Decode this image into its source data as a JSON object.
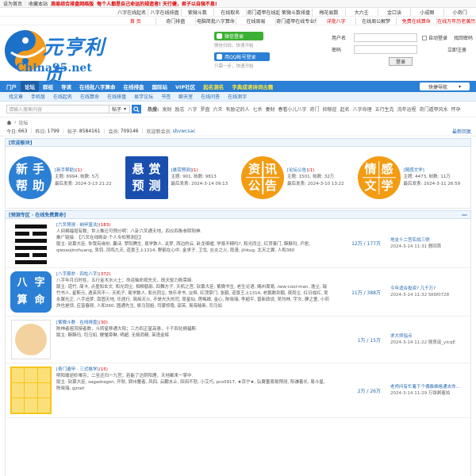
{
  "topbar": {
    "set_home": "设为首页",
    "bookmark": "收藏本站",
    "promo1": "周易综合排盘网络版",
    "promo2": "每个人都是自己命运的规造者! 天行健，君子以自强不息!"
  },
  "links1": [
    "八字在线起名",
    "八字在线排盘",
    "紫微斗数",
    "在线取名",
    "奇门遁甲在线起局",
    "紫微斗数排盘",
    "梅花易数",
    "大六壬",
    "金口诀",
    "小成图",
    "小奇门"
  ],
  "links2": [
    "首 页",
    "奇门排盘",
    "电脑简批八字算命",
    "在线周易",
    "奇门遁甲在线专业版",
    "详批八字",
    "在线周公解梦",
    "免费在线算命",
    "在线万年历老黄历"
  ],
  "links2_hot": [
    0,
    5,
    7,
    8
  ],
  "logo": {
    "cn": "元亨利贞",
    "url": "China95.net"
  },
  "social": {
    "wx_label": "微信登录",
    "wx_note": "微信扫码，快速开始",
    "qq_label": "用QQ帐号登录",
    "qq_note": "只需一步，快速开始"
  },
  "login": {
    "user_label": "用户名",
    "pass_label": "密码",
    "auto_login": "自动登录",
    "retrieve": "找回密码",
    "register": "立即注册",
    "login_btn": "登录"
  },
  "nav": {
    "items": [
      "门户",
      "论坛",
      "群组",
      "导读",
      "在线批八字算命",
      "在线排盘",
      "国际站",
      "VIP社区",
      "起名测名",
      "字典成语诗词古籍"
    ],
    "yellow": [
      8,
      9
    ],
    "quick": "快捷导航"
  },
  "subnav": [
    "找文章",
    "手机版",
    "在线起名",
    "在线算命",
    "在线排盘",
    "易学论坛",
    "书签",
    "聊天室",
    "在线问答",
    "在线测字"
  ],
  "search": {
    "placeholder": "请输入搜索内容",
    "scope": "帖子",
    "hot_label": "热搜:",
    "hot": [
      "发财",
      "励志",
      "八字",
      "罗盘",
      "六爻",
      "有励记的人",
      "七杀",
      "妻财",
      "春看小儿八字",
      "奇门",
      "抑郁症",
      "起名",
      "八字命理",
      "五行生克",
      "流年运程",
      "奇门遁甲风水",
      "怀孕"
    ]
  },
  "crumb": {
    "home_icon": "home-icon",
    "sep": "›",
    "current": "论坛"
  },
  "stats": {
    "today_label": "今日:",
    "today": "663",
    "yesterday_label": "昨日:",
    "yesterday": "1799",
    "posts_label": "帖子:",
    "posts": "8584161",
    "members_label": "会员:",
    "members": "709146",
    "welcome_label": "欢迎新会员:",
    "newest": "sbvwcsac",
    "latest_link": "最新回复"
  },
  "welcome_section": {
    "title": "[欢迎板块]"
  },
  "welcome": [
    {
      "icon_chars": [
        "新",
        "手",
        "帮",
        "助"
      ],
      "title": "[新手帮助]",
      "count": "(1)",
      "topics": "主题: 6994, 帖数: 5万",
      "last": "最后发表: 2024-3-13 21:22"
    },
    {
      "icon_chars": [
        "悬",
        "赏",
        "预",
        "测"
      ],
      "title": "[悬赏预测]",
      "count": "(1)",
      "topics": "主题: 901, 帖数: 9813",
      "last": "最后发表: 2024-3-14 09:13"
    },
    {
      "icon_chars": [
        "资",
        "讯",
        "公",
        "告"
      ],
      "title": "[论坛公告]",
      "count": "(1)",
      "topics": "主题: 1501, 帖数: 32万",
      "last": "最后发表: 2024-3-10 13:22"
    },
    {
      "icon_chars": [
        "情",
        "感",
        "文",
        "学"
      ],
      "title": "[随感文学]",
      "count": "",
      "topics": "主题: 4473, 帖数: 11万",
      "last": "最后发表: 2024-3-11 26:59"
    }
  ],
  "forum_section": {
    "title": "[预测专区 · 在线免费算命]",
    "collapse": "—"
  },
  "forums": [
    {
      "title": "[六爻预测 · 纳甲筮法]",
      "count": "(183)",
      "lines": [
        "人间祸福增有数，世上推迁可预分明：八卦六爻通天地，四仪四象参阴阳神.",
        "推广链接: 【六爻在线断卦·个人专知预测区】",
        "版主: 钦慕大臣, 你我有缘份, 囊诗, 梦阳腾生, 易学数人, 关梦, 西边的云, 卧龙嗔嘘, 学易不精吗?, 和光同尘, 红顶事门, 酥酥玛, 卢居, qwoaojinzhuang, 吴钧, 凤鸣九天, 道景王上1314, 野鹤在心中, 金求子, 卫戈, 炎炎之火, 雨漫, jihkug, 北天之翼, 人和360"
      ],
      "stat": "12万 / 177万",
      "last_title": "地支十二宫实战三例",
      "last_meta": "2024-3-14 11:31 鹿回首"
    },
    {
      "title": "[八字算命 · 四柱八字]",
      "count": "(372)",
      "lines": [
        "八字年月日时柱，五行金木水火土；命运轴命观先天，既天驱力断荣络.",
        "版主: 道竹, 简卡, 点墨知玄文, 和光同尘, 相柳鹤影, 四舞方子, 天机之宫, 钦慕大臣, 紫微书生, 老生论语, 赐州周易, new-cool-man, 逸尘, 瑞竹书人, 星斯元, 遇芙风不~, 天机子, 易学数人, 和光同尘, 快乐寻书, 淡恒, 红顶掌门, 张鹤, 道景王上1314, 老鹅数到鹅, 夜雨尘, 红日成红, 吴永翼光正, 八字追梦, 南固天地, 乐居行, 简焰天火, 不是光头的司, 昆星仙, 莲梅娘, 金心, 陈晓瑞, 李超平, 曾新政说, 吴均林, 宇文, 静之童, 小煎炸也是烦, 应富春原, 人和360, 圆通先生, 侯马冠姐, 司蒙修隐, 邵芙, 易海秘新, 司马如"
      ],
      "stat": "11万 / 388万",
      "last_title": "今年适合投资? 几千万?",
      "last_meta": "2024-3-14 11:32 SKW0728"
    },
    {
      "title": "[紫微斗数 · 在线排盘]",
      "count": "(30)",
      "lines": [
        "陈神者祖流授者数，斗转星移通大阳；三方四正星高悬，十干四化祸福斯.",
        "版主: 酥酥玛, 司马如, 梗懂旁琳, 明超, 无极而精, 茉语金辉"
      ],
      "stat": "1万 / 15万",
      "last_title": "求大师指点",
      "last_meta": "2024-3-14 11:22 随意诞_yIcqE"
    },
    {
      "title": "[奇门遁甲 · 三式格学]",
      "count": "(15)",
      "lines": [
        "明阳顺逆妙难穷，二至还归一九宫；若能了达阴阳理，天地都来一掌中.",
        "版主: 钦慕大臣, sagadragon, 开秋, 郢州雁者, 风四, 云翻水止, 田田不怒, 小艾巧, pcs0917, ★百宁★, 弘翼董周易预测, 阳谦着长, 易斗星, 陈晓瑞, gznet"
      ],
      "stat": "2万 / 26万",
      "last_title": "老师问有忙着下个偶像维格通去命…",
      "last_meta": "2024-3-14 11:29 万铢剩着拍"
    }
  ]
}
